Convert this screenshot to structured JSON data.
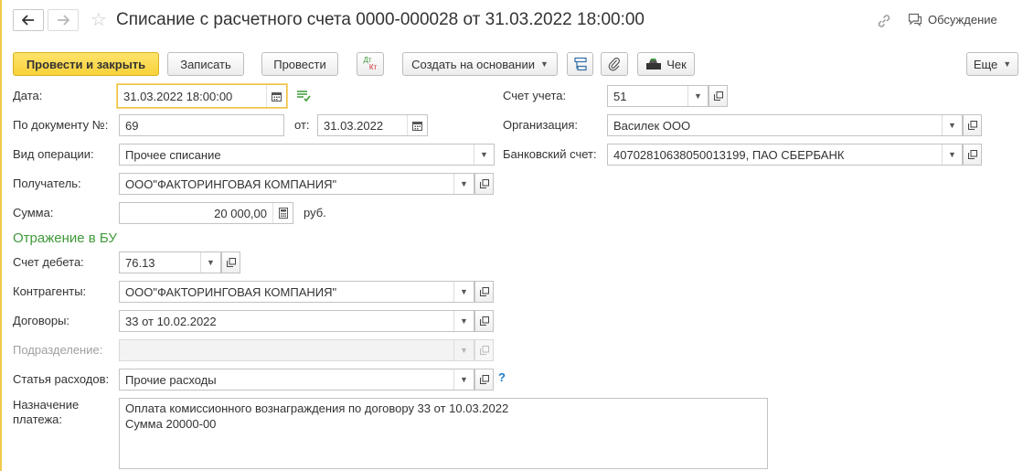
{
  "window": {
    "title": "Списание с расчетного счета 0000-000028 от 31.03.2022 18:00:00",
    "discussion_label": "Обсуждение"
  },
  "toolbar": {
    "post_close_label": "Провести и закрыть",
    "save_label": "Записать",
    "post_label": "Провести",
    "dt_label": "Дт",
    "kt_label": "Кт",
    "create_based_label": "Создать на основании",
    "receipt_label": "Чек",
    "more_label": "Еще"
  },
  "form": {
    "date_label": "Дата:",
    "date_value": "31.03.2022 18:00:00",
    "doc_number_label": "По документу №:",
    "doc_number_value": "69",
    "from_label": "от:",
    "from_value": "31.03.2022",
    "operation_label": "Вид операции:",
    "operation_value": "Прочее списание",
    "recipient_label": "Получатель:",
    "recipient_value": "ООО\"ФАКТОРИНГОВАЯ КОМПАНИЯ\"",
    "amount_label": "Сумма:",
    "amount_value": "20 000,00",
    "currency_label": "руб.",
    "account_label": "Счет учета:",
    "account_value": "51",
    "organization_label": "Организация:",
    "organization_value": "Василек ООО",
    "bank_account_label": "Банковский счет:",
    "bank_account_value": "40702810638050013199, ПАО СБЕРБАНК"
  },
  "accounting": {
    "section_title": "Отражение в БУ",
    "debit_label": "Счет дебета:",
    "debit_value": "76.13",
    "counterparty_label": "Контрагенты:",
    "counterparty_value": "ООО\"ФАКТОРИНГОВАЯ КОМПАНИЯ\"",
    "contract_label": "Договоры:",
    "contract_value": "33 от 10.02.2022",
    "division_label": "Подразделение:",
    "division_value": "",
    "expense_label": "Статья расходов:",
    "expense_value": "Прочие расходы",
    "help_label": "?",
    "purpose_label_1": "Назначение",
    "purpose_label_2": "платежа:",
    "purpose_line_1": "Оплата комиссионного вознаграждения по договору 33 от 10.03.2022",
    "purpose_line_2": "Сумма 20000-00"
  },
  "colors": {
    "primary_button": "#f8d23a",
    "section_title": "#3f9a39",
    "focus_border": "#f0c24a",
    "help": "#1e7ac4"
  }
}
